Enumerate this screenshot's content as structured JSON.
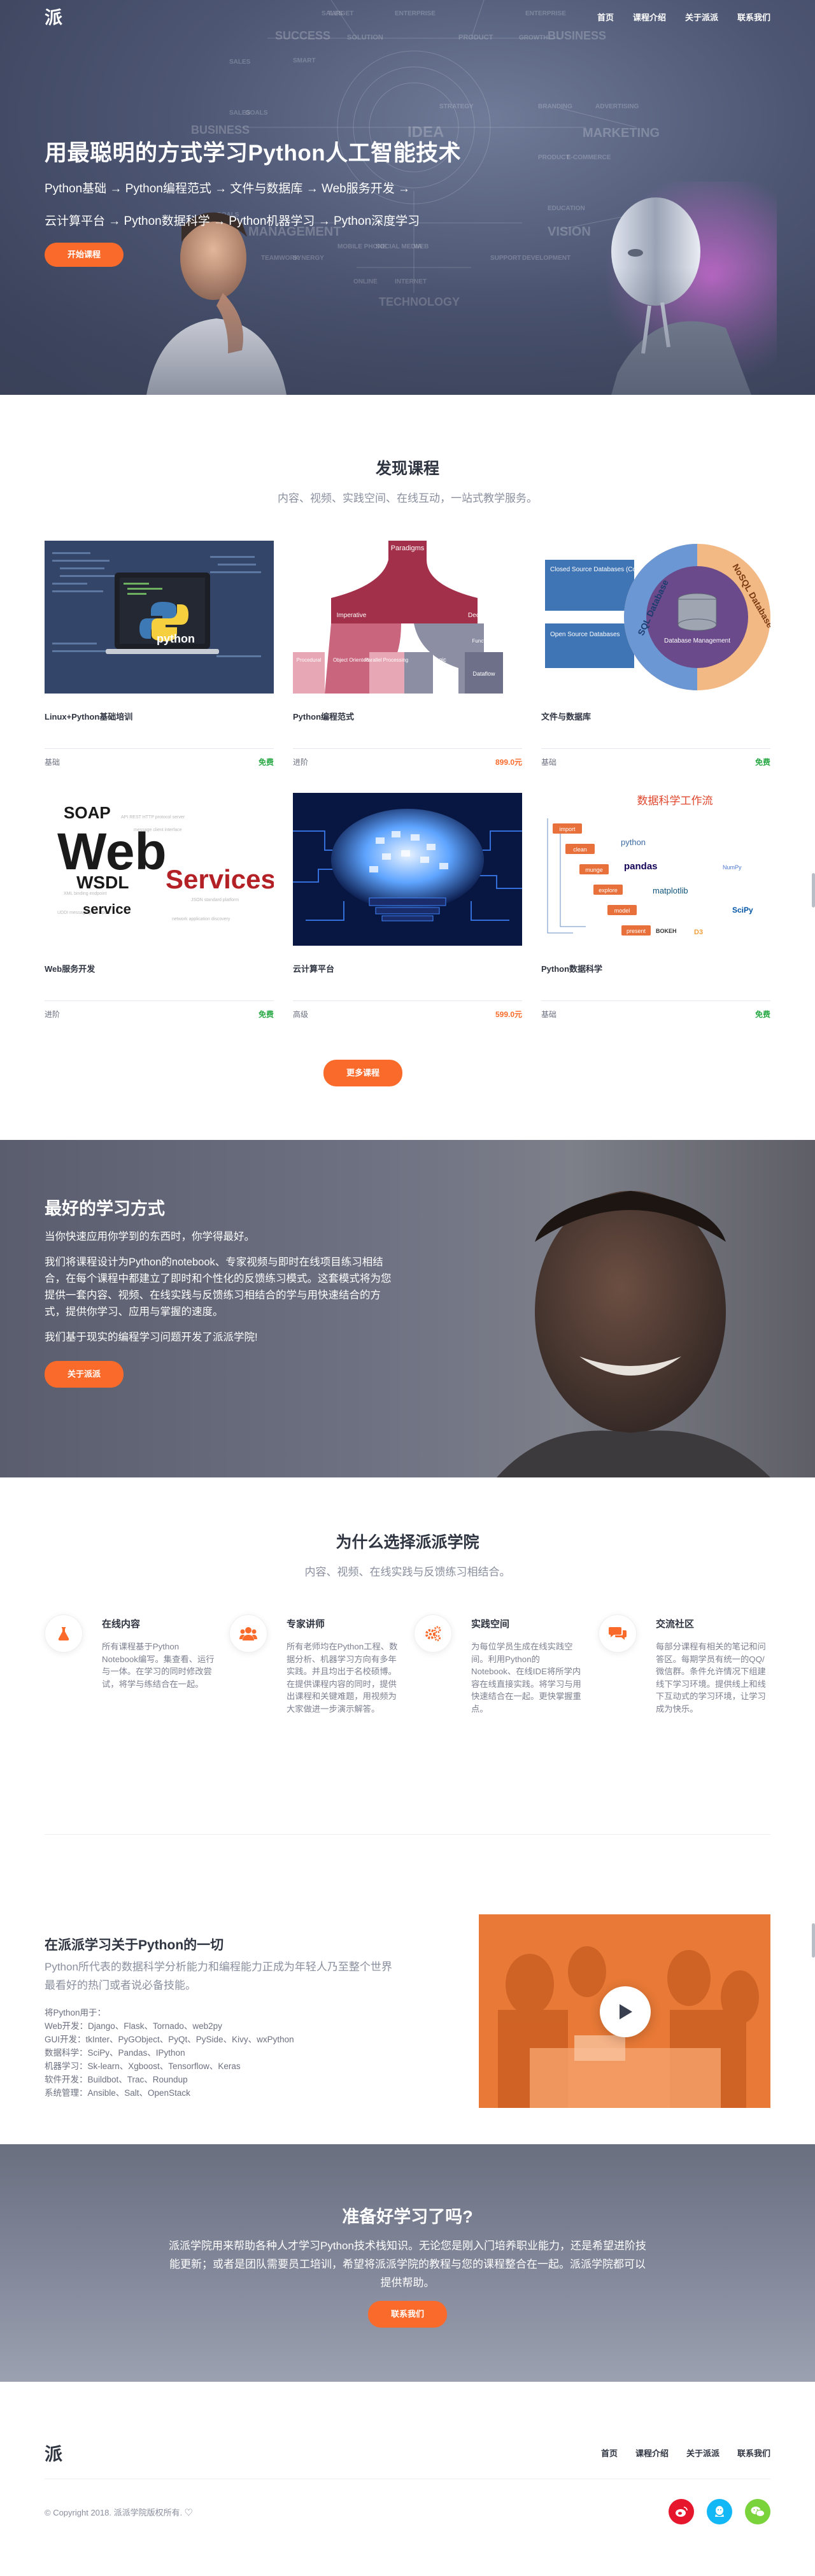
{
  "colors": {
    "accent": "#fa6b2b",
    "free": "#27a844",
    "hero_bg": "#4d5673",
    "text": "#2f3441"
  },
  "nav": {
    "logo": "派",
    "links": [
      "首页",
      "课程介绍",
      "关于派派",
      "联系我们"
    ]
  },
  "hero": {
    "title": "用最聪明的方式学习Python人工智能技术",
    "line1": "Python基础 → Python编程范式 → 文件与数据库 → Web服务开发 →",
    "line2": "云计算平台 → Python数据科学 → Python机器学习 → Python深度学习",
    "cta": "开始课程",
    "bg_words": [
      "SALES",
      "TARGET",
      "SUCCESS",
      "SOLUTION",
      "SMART",
      "IDEA",
      "BUSINESS",
      "STRATEGY",
      "PRODUCT",
      "GROWTH",
      "MARKETING",
      "BRANDING",
      "ADVERTISING",
      "PRODUCT",
      "E-COMMERCE",
      "MANAGEMENT",
      "TEAMWORK",
      "SYNERGY",
      "MOBILE PHONE",
      "SOCIAL MEDIA",
      "WEB",
      "VISION",
      "SUPPORT",
      "DEVELOPMENT",
      "EDUCATION",
      "ONLINE",
      "INTERNET",
      "TECHNOLOGY",
      "ENTERPRISE",
      "GOALS",
      "SALES",
      "ENTERPRISE",
      "BUSINESS",
      "SALES",
      "GOALS"
    ]
  },
  "courses": {
    "title": "发现课程",
    "subtitle": "内容、视频、实践空间、在线互动，一站式教学服务。",
    "more": "更多课程",
    "items": [
      {
        "name": "Linux+Python基础培训",
        "level": "基础",
        "price": "免费",
        "free": true
      },
      {
        "name": "Python编程范式",
        "level": "进阶",
        "price": "899.0元",
        "free": false
      },
      {
        "name": "文件与数据库",
        "level": "基础",
        "price": "免费",
        "free": true
      },
      {
        "name": "Web服务开发",
        "level": "进阶",
        "price": "免费",
        "free": true
      },
      {
        "name": "云计算平台",
        "level": "高级",
        "price": "599.0元",
        "free": false
      },
      {
        "name": "Python数据科学",
        "level": "基础",
        "price": "免费",
        "free": true
      }
    ],
    "thumbs": {
      "python_logo": "python",
      "paradigms": {
        "top": "Paradigms",
        "imperative": "Imperative",
        "declarative": "Declarative",
        "object": "Object Oriented",
        "parallel": "Parallel Processing",
        "logic": "Logic",
        "functional": "Functional",
        "procedural": "Procedural",
        "dataflow": "Dataflow"
      },
      "database": {
        "left_box": "Closed Source Databases (Commercial Vendor Database)",
        "left_box2": "Open Source Databases",
        "sql": "SQL Database",
        "nosql": "NoSQL Database",
        "center": "Database Management"
      },
      "web": {
        "soap": "SOAP",
        "web": "Web",
        "services": "Services",
        "wsdl": "WSDL",
        "service": "service"
      },
      "datasci": {
        "title": "数据科学工作流",
        "steps": [
          "import",
          "clean",
          "munge",
          "explore",
          "model",
          "present"
        ],
        "libs": [
          "python",
          "pandas",
          "matplotlib",
          "NumPy",
          "SciPy",
          "BOKEH",
          "D3"
        ]
      }
    }
  },
  "best": {
    "title": "最好的学习方式",
    "p1": "当你快速应用你学到的东西时，你学得最好。",
    "p2": "我们将课程设计为Python的notebook、专家视频与即时在线项目练习相结合，在每个课程中都建立了即时和个性化的反馈练习模式。这套模式将为您提供一套内容、视频、在线实践与反馈练习相结合的学与用快速结合的方式，提供你学习、应用与掌握的速度。",
    "p3": "我们基于现实的编程学习问题开发了派派学院!",
    "cta": "关于派派"
  },
  "why": {
    "title": "为什么选择派派学院",
    "subtitle": "内容、视频、在线实践与反馈练习相结合。",
    "features": [
      {
        "icon": "flask-icon",
        "title": "在线内容",
        "text": "所有课程基于Python Notebook编写。集查看、运行与一体。在学习的同时修改尝试，将学与练结合在一起。"
      },
      {
        "icon": "users-icon",
        "title": "专家讲师",
        "text": "所有老师均在Python工程、数据分析、机器学习方向有多年实践。并且均出于名校硕博。在提供课程内容的同时，提供出课程和关键难题，用视频为大家做进一步演示解答。"
      },
      {
        "icon": "gears-icon",
        "title": "实践空间",
        "text": "为每位学员生成在线实践空间。利用Python的Notebook、在线IDE将所学内容在线直接实践。将学习与用快速结合在一起。更快掌握重点。"
      },
      {
        "icon": "chat-icon",
        "title": "交流社区",
        "text": "每部分课程有相关的笔记和问答区。每期学员有统一的QQ/微信群。条件允许情况下组建线下学习环境。提供线上和线下互动式的学习环境，让学习成为快乐。"
      }
    ]
  },
  "about": {
    "title": "在派派学习关于Python的一切",
    "lead": "Python所代表的数据科学分析能力和编程能力正成为年轻人乃至整个世界最看好的热门或者说必备技能。",
    "list": [
      "将Python用于：",
      "Web开发：Django、Flask、Tornado、web2py",
      "GUI开发：tkInter、PyGObject、PyQt、PySide、Kivy、wxPython",
      "数据科学：SciPy、Pandas、IPython",
      "机器学习：Sk-learn、Xgboost、Tensorflow、Keras",
      "软件开发：Buildbot、Trac、Roundup",
      "系统管理：Ansible、Salt、OpenStack"
    ]
  },
  "ready": {
    "title": "准备好学习了吗?",
    "text": "派派学院用来帮助各种人才学习Python技术栈知识。无论您是刚入门培养职业能力，还是希望进阶技能更新；或者是团队需要员工培训，希望将派派学院的教程与您的课程整合在一起。派派学院都可以提供帮助。",
    "cta": "联系我们"
  },
  "footer": {
    "logo": "派",
    "links": [
      "首页",
      "课程介绍",
      "关于派派",
      "联系我们"
    ],
    "copyright": "© Copyright 2018. 派派学院版权所有. ♡",
    "socials": [
      {
        "icon": "weibo-icon",
        "color": "#e6162d"
      },
      {
        "icon": "qq-icon",
        "color": "#12b7f5"
      },
      {
        "icon": "wechat-icon",
        "color": "#7bd33b"
      }
    ]
  }
}
